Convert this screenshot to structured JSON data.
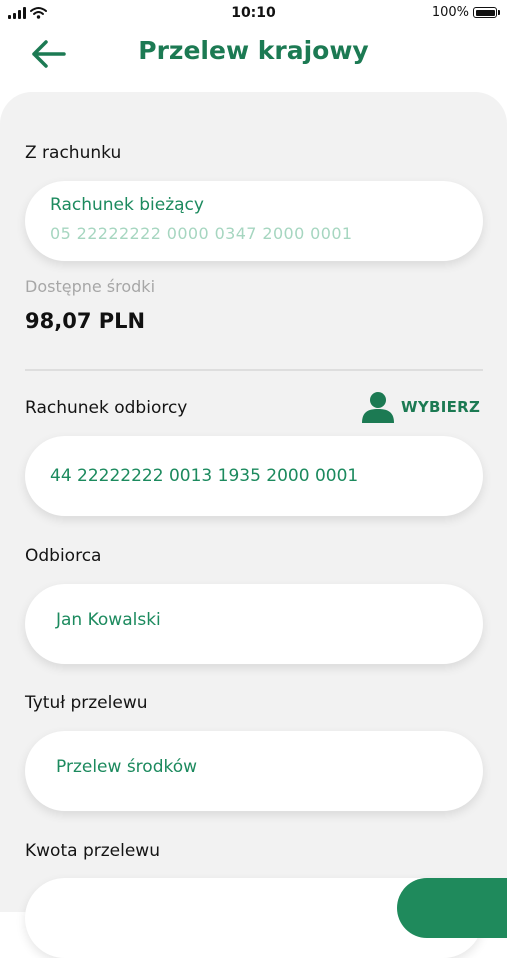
{
  "status_bar": {
    "time": "10:10",
    "battery": "100%"
  },
  "header": {
    "title": "Przelew krajowy"
  },
  "from_account": {
    "label": "Z rachunku",
    "account_name": "Rachunek bieżący",
    "account_number": "05 22222222 0000 0347 2000 0001"
  },
  "available": {
    "label": "Dostępne środki",
    "amount": "98,07 PLN"
  },
  "recipient_account": {
    "label": "Rachunek odbiorcy",
    "choose_label": "WYBIERZ",
    "value": "44 22222222 0013 1935 2000 0001"
  },
  "recipient": {
    "label": "Odbiorca",
    "value": "Jan Kowalski"
  },
  "title_field": {
    "label": "Tytuł przelewu",
    "value": "Przelew środków"
  },
  "amount": {
    "label": "Kwota przelewu",
    "value": ""
  },
  "colors": {
    "accent": "#1c7a53",
    "value_text": "#1c8a5e",
    "card_bg": "#f2f2f2"
  },
  "icons": [
    "signal-icon",
    "wifi-icon",
    "battery-icon",
    "back-arrow-icon",
    "person-icon"
  ]
}
